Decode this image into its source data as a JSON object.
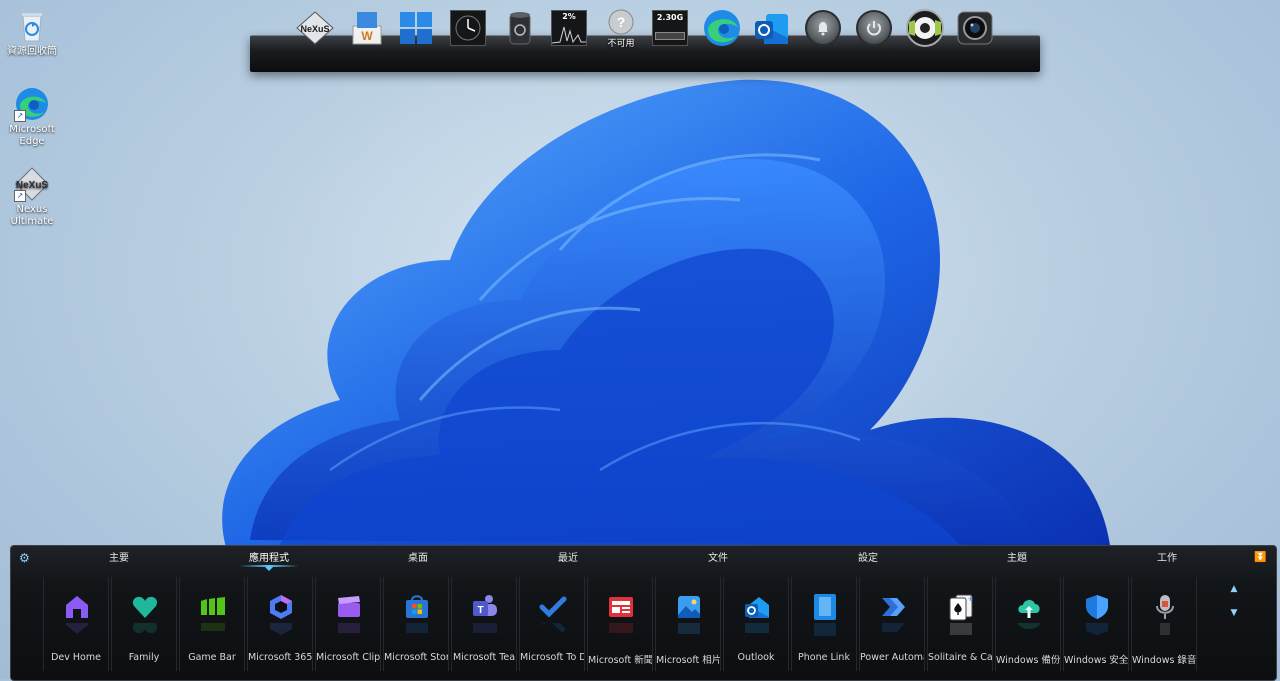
{
  "desktop": {
    "icons": [
      {
        "label": "資源回收筒",
        "icon": "recycle-bin-icon"
      },
      {
        "label": "Microsoft Edge",
        "icon": "edge-icon"
      },
      {
        "label": "Nexus Ultimate",
        "icon": "nexus-icon"
      }
    ]
  },
  "dock": {
    "items": [
      {
        "name": "nexus-logo-icon",
        "text": "NeXuS"
      },
      {
        "name": "winstep-icon",
        "text": ""
      },
      {
        "name": "windows-start-icon",
        "text": ""
      },
      {
        "name": "clock-icon",
        "text": ""
      },
      {
        "name": "recycle-bin-dock-icon",
        "text": ""
      },
      {
        "name": "cpu-meter-icon",
        "text": "2%"
      },
      {
        "name": "unavailable-icon",
        "text": "不可用"
      },
      {
        "name": "memory-meter-icon",
        "text": "2.30G"
      },
      {
        "name": "edge-dock-icon",
        "text": ""
      },
      {
        "name": "outlook-dock-icon",
        "text": ""
      },
      {
        "name": "notification-bell-icon",
        "text": ""
      },
      {
        "name": "power-icon",
        "text": ""
      },
      {
        "name": "media-player-icon",
        "text": ""
      },
      {
        "name": "camera-icon",
        "text": ""
      }
    ]
  },
  "panel": {
    "tabs": [
      "主要",
      "應用程式",
      "桌面",
      "最近",
      "文件",
      "設定",
      "主題",
      "工作"
    ],
    "active_tab": "應用程式",
    "apps": [
      {
        "label": "Dev Home",
        "icon": "dev-home-icon",
        "color": "#8a5cf5"
      },
      {
        "label": "Family",
        "icon": "family-heart-icon",
        "color": "#1fb89a"
      },
      {
        "label": "Game Bar",
        "icon": "game-bar-icon",
        "color": "#52c41a"
      },
      {
        "label": "Microsoft 365",
        "icon": "microsoft-365-icon",
        "color": "#4b7bf5"
      },
      {
        "label": "Microsoft Clipc",
        "icon": "clipchamp-icon",
        "color": "#9a5cf0"
      },
      {
        "label": "Microsoft Stor",
        "icon": "store-icon",
        "color": "#2a74d6"
      },
      {
        "label": "Microsoft Tea",
        "icon": "teams-icon",
        "color": "#6b63d6"
      },
      {
        "label": "Microsoft To D",
        "icon": "todo-check-icon",
        "color": "#2f7de0"
      },
      {
        "label": "Microsoft 新聞",
        "icon": "news-icon",
        "color": "#e0323c"
      },
      {
        "label": "Microsoft 相片",
        "icon": "photos-icon",
        "color": "#3b9df0"
      },
      {
        "label": "Outlook",
        "icon": "outlook-icon",
        "color": "#1a73d0"
      },
      {
        "label": "Phone Link",
        "icon": "phone-link-icon",
        "color": "#1e88e5"
      },
      {
        "label": "Power Automa",
        "icon": "power-automate-icon",
        "color": "#2f6fd8"
      },
      {
        "label": "Solitaire & Cas",
        "icon": "solitaire-icon",
        "color": "#ffffff"
      },
      {
        "label": "Windows 備份",
        "icon": "backup-cloud-icon",
        "color": "#2ec4a6"
      },
      {
        "label": "Windows 安全",
        "icon": "security-shield-icon",
        "color": "#1f7ae0"
      },
      {
        "label": "Windows 錄音",
        "icon": "recorder-mic-icon",
        "color": "#9aa0a6"
      }
    ]
  }
}
